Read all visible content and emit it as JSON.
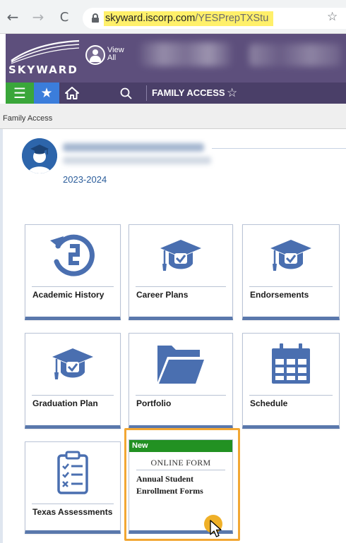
{
  "browser": {
    "url_host": "skyward.iscorp.com",
    "url_path": "/YESPrepTXStu",
    "back_glyph": "←",
    "forward_glyph": "→",
    "reload_glyph": "C",
    "bookmark_glyph": "☆"
  },
  "header": {
    "logo": "SKYWARD",
    "view_all_line1": "View",
    "view_all_line2": "All"
  },
  "nav": {
    "menu_glyph": "☰",
    "star_glyph": "★",
    "search_glyph": "🔍",
    "title": "FAMILY ACCESS",
    "favorite_glyph": "☆"
  },
  "breadcrumb": "Family Access",
  "student": {
    "school_year": "2023-2024"
  },
  "tiles": [
    {
      "label": "Academic History",
      "icon": "history-icon"
    },
    {
      "label": "Career Plans",
      "icon": "graduation-cap-check-icon"
    },
    {
      "label": "Endorsements",
      "icon": "graduation-cap-check-icon"
    },
    {
      "label": "Graduation Plan",
      "icon": "graduation-cap-check-icon"
    },
    {
      "label": "Portfolio",
      "icon": "folder-icon"
    },
    {
      "label": "Schedule",
      "icon": "calendar-icon"
    },
    {
      "label": "Texas Assessments",
      "icon": "checklist-clipboard-icon"
    }
  ],
  "form_tile": {
    "badge": "New",
    "title": "ONLINE FORM",
    "description": "Annual Student Enrollment Forms"
  },
  "colors": {
    "header_purple": "#5d4f7c",
    "nav_green": "#3aa63a",
    "nav_blue": "#3b7ddb",
    "icon_blue": "#4a6fb0",
    "new_green": "#229122",
    "highlight_orange": "#f2a734"
  }
}
